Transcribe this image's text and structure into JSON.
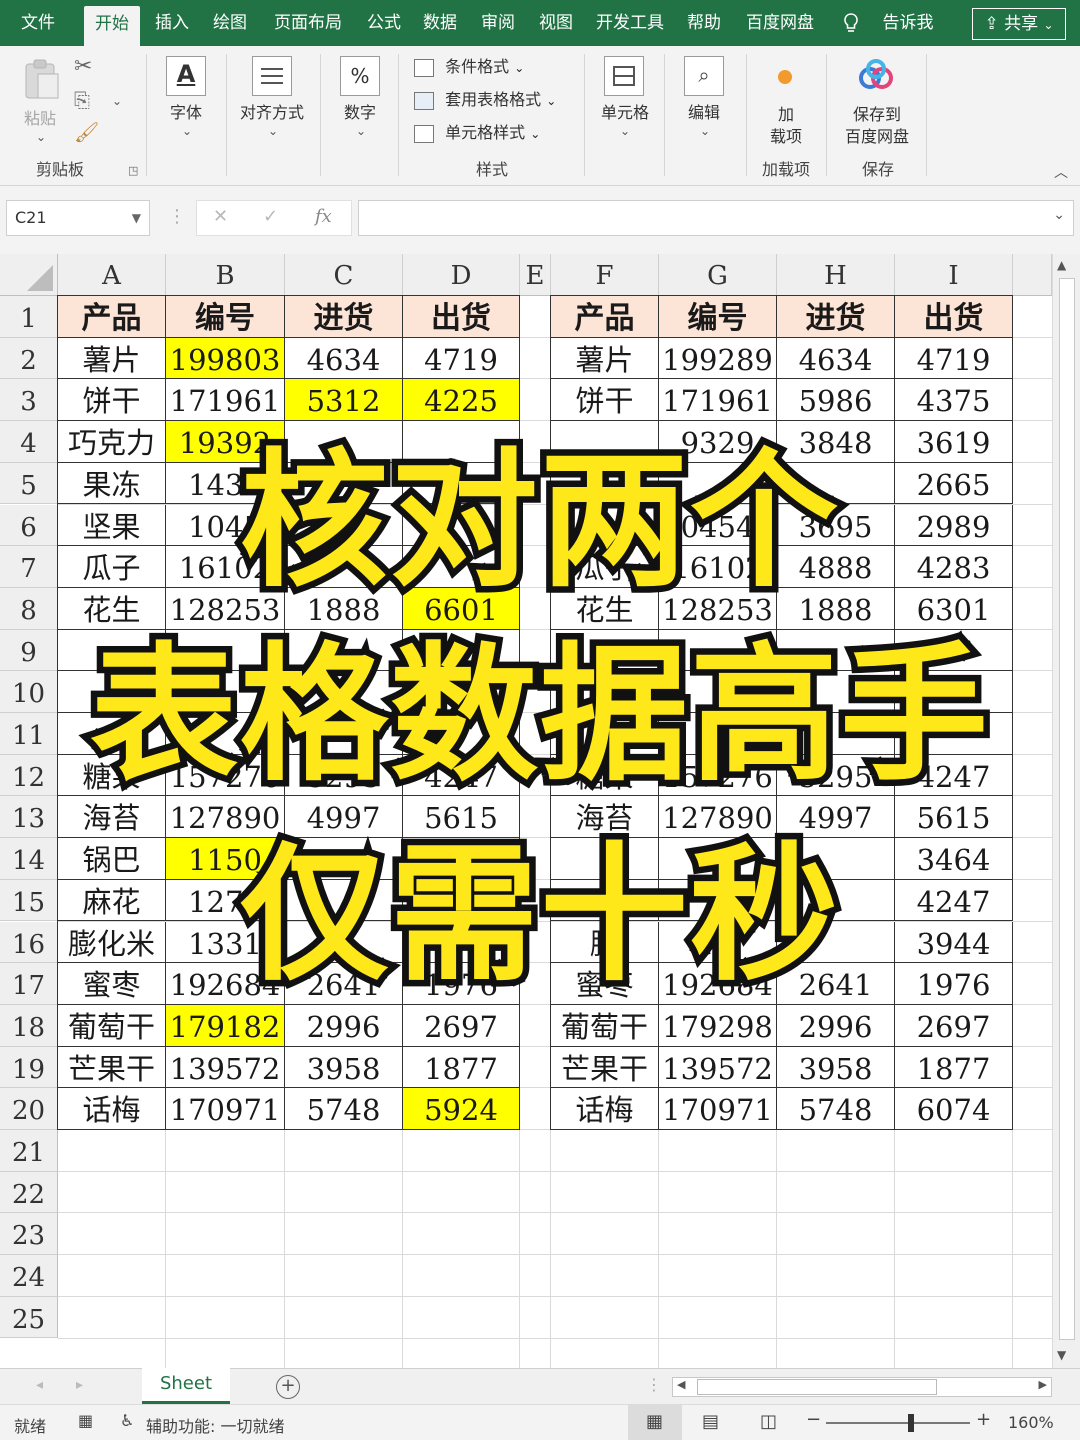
{
  "tabs": [
    "文件",
    "开始",
    "插入",
    "绘图",
    "页面布局",
    "公式",
    "数据",
    "审阅",
    "视图",
    "开发工具",
    "帮助",
    "百度网盘",
    "告诉我"
  ],
  "share_label": "共享",
  "ribbon": {
    "clipboard": {
      "paste": "粘贴",
      "group": "剪贴板"
    },
    "font": "字体",
    "alignment": "对齐方式",
    "number": "数字",
    "styles": {
      "conditional": "条件格式",
      "table_format": "套用表格格式",
      "cell_style": "单元格样式",
      "group": "样式"
    },
    "cells": "单元格",
    "editing": "编辑",
    "addins": {
      "line1": "加",
      "line2": "载项",
      "group": "加载项"
    },
    "save_baidu": {
      "line1": "保存到",
      "line2": "百度网盘",
      "group": "保存"
    }
  },
  "formula_bar": {
    "name_box": "C21",
    "fx": "fx"
  },
  "columns": [
    "A",
    "B",
    "C",
    "D",
    "E",
    "F",
    "G",
    "H",
    "I"
  ],
  "rows": [
    "1",
    "2",
    "3",
    "4",
    "5",
    "6",
    "7",
    "8",
    "9",
    "10",
    "11",
    "12",
    "13",
    "14",
    "15",
    "16",
    "17",
    "18",
    "19",
    "20",
    "21",
    "22",
    "23",
    "24",
    "25"
  ],
  "table_left": {
    "headers": [
      "产品",
      "编号",
      "进货",
      "出货"
    ],
    "rows": [
      {
        "cells": [
          "薯片",
          "199803",
          "4634",
          "4719"
        ],
        "highlight": [
          false,
          true,
          false,
          false
        ]
      },
      {
        "cells": [
          "饼干",
          "171961",
          "5312",
          "4225"
        ],
        "highlight": [
          false,
          false,
          true,
          true
        ]
      },
      {
        "cells": [
          "巧克力",
          "19392",
          "",
          ""
        ],
        "highlight": [
          false,
          true,
          false,
          false
        ]
      },
      {
        "cells": [
          "果冻",
          "1432",
          "",
          ""
        ],
        "highlight": [
          false,
          false,
          false,
          false
        ]
      },
      {
        "cells": [
          "坚果",
          "1045",
          "",
          ""
        ],
        "highlight": [
          false,
          false,
          false,
          false
        ]
      },
      {
        "cells": [
          "瓜子",
          "16102",
          "",
          ""
        ],
        "highlight": [
          false,
          false,
          false,
          false
        ]
      },
      {
        "cells": [
          "花生",
          "128253",
          "1888",
          "6601"
        ],
        "highlight": [
          false,
          false,
          false,
          true
        ]
      },
      {
        "cells": [
          "",
          "",
          "",
          ""
        ],
        "highlight": [
          false,
          false,
          false,
          false
        ]
      },
      {
        "cells": [
          "",
          "",
          "",
          ""
        ],
        "highlight": [
          false,
          false,
          false,
          false
        ]
      },
      {
        "cells": [
          "",
          "",
          "",
          ""
        ],
        "highlight": [
          false,
          false,
          false,
          false
        ]
      },
      {
        "cells": [
          "糖果",
          "157276",
          "5295",
          "4247"
        ],
        "highlight": [
          false,
          false,
          false,
          false
        ]
      },
      {
        "cells": [
          "海苔",
          "127890",
          "4997",
          "5615"
        ],
        "highlight": [
          false,
          false,
          false,
          false
        ]
      },
      {
        "cells": [
          "锅巴",
          "1150",
          "",
          ""
        ],
        "highlight": [
          false,
          true,
          false,
          false
        ]
      },
      {
        "cells": [
          "麻花",
          "1274",
          "",
          ""
        ],
        "highlight": [
          false,
          false,
          false,
          false
        ]
      },
      {
        "cells": [
          "膨化米",
          "1331",
          "",
          ""
        ],
        "highlight": [
          false,
          false,
          false,
          false
        ]
      },
      {
        "cells": [
          "蜜枣",
          "192684",
          "2641",
          "1976"
        ],
        "highlight": [
          false,
          false,
          false,
          false
        ]
      },
      {
        "cells": [
          "葡萄干",
          "179182",
          "2996",
          "2697"
        ],
        "highlight": [
          false,
          true,
          false,
          false
        ]
      },
      {
        "cells": [
          "芒果干",
          "139572",
          "3958",
          "1877"
        ],
        "highlight": [
          false,
          false,
          false,
          false
        ]
      },
      {
        "cells": [
          "话梅",
          "170971",
          "5748",
          "5924"
        ],
        "highlight": [
          false,
          false,
          false,
          true
        ]
      }
    ]
  },
  "table_right": {
    "headers": [
      "产品",
      "编号",
      "进货",
      "出货"
    ],
    "rows": [
      [
        "薯片",
        "199289",
        "4634",
        "4719"
      ],
      [
        "饼干",
        "171961",
        "5986",
        "4375"
      ],
      [
        "",
        "9329",
        "3848",
        "3619"
      ],
      [
        "",
        "",
        "",
        "2665"
      ],
      [
        "",
        "0454",
        "3695",
        "2989"
      ],
      [
        "瓜子",
        "16102",
        "4888",
        "4283"
      ],
      [
        "花生",
        "128253",
        "1888",
        "6301"
      ],
      [
        "",
        "",
        "",
        ""
      ],
      [
        "",
        "",
        "",
        ""
      ],
      [
        "",
        "",
        "",
        ""
      ],
      [
        "糖果",
        "157276",
        "5295",
        "4247"
      ],
      [
        "海苔",
        "127890",
        "4997",
        "5615"
      ],
      [
        "",
        "",
        "",
        "3464"
      ],
      [
        "",
        "",
        "",
        "4247"
      ],
      [
        "膨",
        "",
        "",
        "3944"
      ],
      [
        "蜜枣",
        "192684",
        "2641",
        "1976"
      ],
      [
        "葡萄干",
        "179298",
        "2996",
        "2697"
      ],
      [
        "芒果干",
        "139572",
        "3958",
        "1877"
      ],
      [
        "话梅",
        "170971",
        "5748",
        "6074"
      ]
    ]
  },
  "overlay": {
    "line1": "核对两个",
    "line2": "表格数据高手",
    "line3": "仅需十秒"
  },
  "sheet_tab": "Sheet",
  "status": {
    "ready": "就绪",
    "accessibility": "辅助功能: 一切就绪",
    "zoom": "160%"
  },
  "colors": {
    "accent": "#217346",
    "highlight": "#ffff00",
    "header_fill": "#fce4d6",
    "overlay_text": "#ffe81a"
  }
}
